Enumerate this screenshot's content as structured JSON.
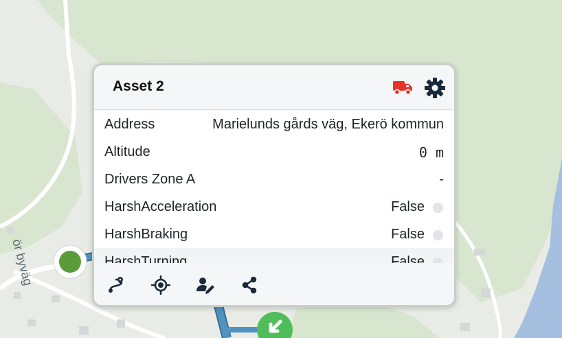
{
  "map": {
    "road_label": "ör byväg",
    "colors": {
      "land": "#e9ece6",
      "forest": "#d8e6d0",
      "water": "#a4bfdf",
      "route": "#4f93c1",
      "start_marker": "#5c9b39",
      "end_marker": "#4fbe5a"
    }
  },
  "popup": {
    "title": "Asset 2",
    "icons": {
      "asset_type": "truck-icon",
      "settings": "gear-icon"
    },
    "rows": [
      {
        "label": "Address",
        "value": "Marielunds gårds väg, Ekerö kommun"
      },
      {
        "label": "Altitude",
        "value": "0 m"
      },
      {
        "label": "Drivers Zone A",
        "value": "-"
      },
      {
        "label": "HarshAcceleration",
        "value": "False",
        "indicator": "grey"
      },
      {
        "label": "HarshBraking",
        "value": "False",
        "indicator": "grey"
      },
      {
        "label": "HarshTurning",
        "value": "False",
        "indicator": "grey"
      }
    ],
    "actions": [
      "route-icon",
      "locate-icon",
      "assign-driver-icon",
      "share-icon"
    ],
    "colors": {
      "truck": "#e5332a",
      "gear": "#1a2a3a",
      "indicator": "#e1e4e9"
    }
  }
}
